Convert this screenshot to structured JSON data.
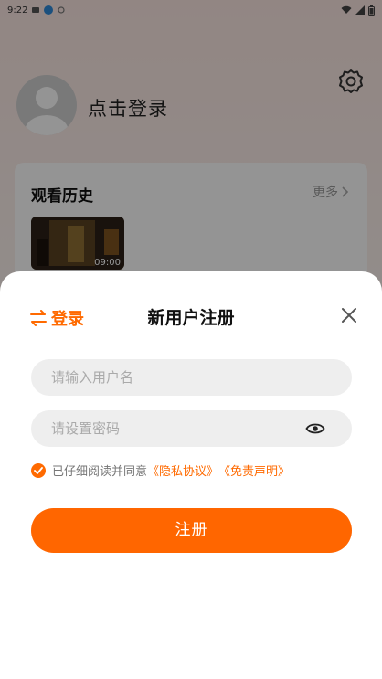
{
  "status_bar": {
    "time": "9:22"
  },
  "profile": {
    "login_prompt": "点击登录"
  },
  "history": {
    "title": "观看历史",
    "more_label": "更多",
    "items": [
      {
        "duration": "09:00"
      }
    ]
  },
  "sheet": {
    "switch_label": "登录",
    "title": "新用户注册",
    "username_placeholder": "请输入用户名",
    "password_placeholder": "请设置密码",
    "agreement_prefix": "已仔细阅读并同意",
    "privacy_link": "《隐私协议》",
    "disclaimer_link": "《免责声明》",
    "register_label": "注册"
  },
  "colors": {
    "accent": "#ff6a00",
    "overlay": "rgba(0,0,0,0.42)"
  },
  "icons": [
    "settings-icon",
    "swap-icon",
    "close-icon",
    "eye-icon",
    "check-icon",
    "chevron-right-icon",
    "wifi-icon",
    "signal-icon",
    "battery-icon"
  ]
}
